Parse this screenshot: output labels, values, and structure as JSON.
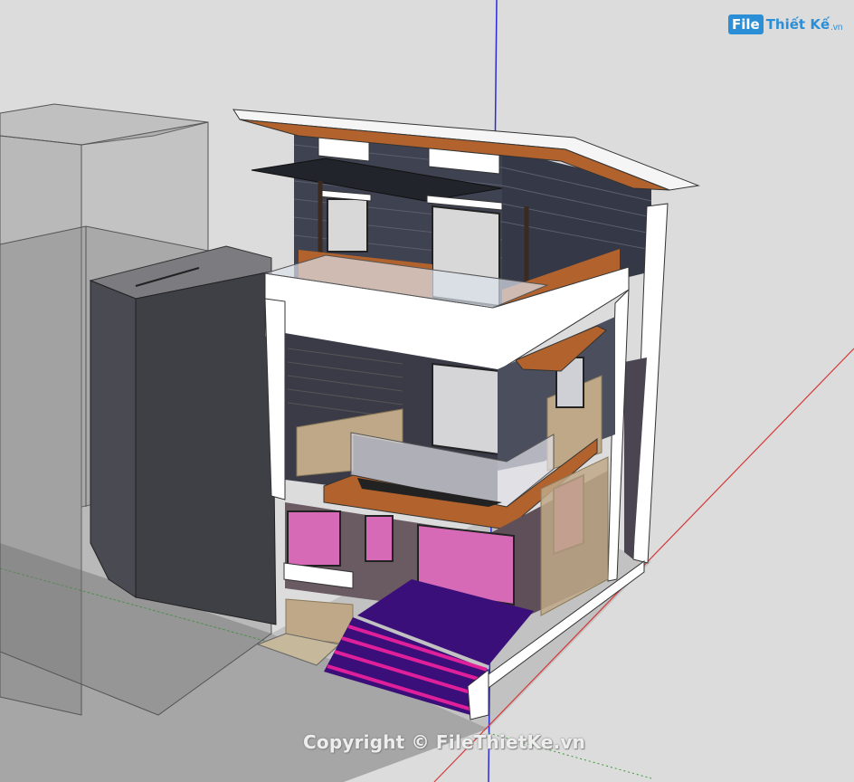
{
  "logo": {
    "box": "File",
    "text": "Thiết Kế",
    "suffix": ".vn"
  },
  "watermark": "Copyright © FileThietKe.vn",
  "colors": {
    "background": "#dcdcdc",
    "axis_blue": "#2b2bd6",
    "axis_red": "#d43a3a",
    "axis_green": "#3a9a3a",
    "ghost_building": "#8a8a8a",
    "dark_neighbor": "#4a4a52",
    "wall_white": "#ffffff",
    "wood": "#b2622c",
    "siding_dark": "#3f4250",
    "stone": "#bfa888",
    "glass_pink": "#d76ab7",
    "floor_purple": "#3b0f7a",
    "stairs_magenta": "#e0209a"
  }
}
